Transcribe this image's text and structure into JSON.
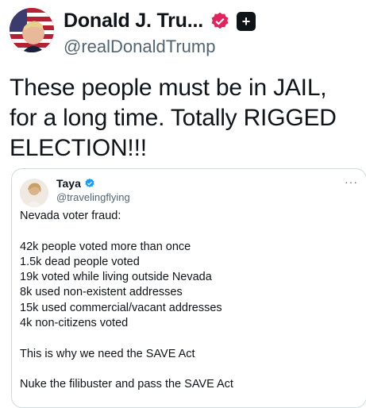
{
  "post": {
    "author_name": "Donald J. Tru...",
    "author_handle": "@realDonaldTrump",
    "text": "These people must be in JAIL, for a long time. Totally RIGGED ELECTION!!!",
    "affiliation_badge": "+"
  },
  "quoted_post": {
    "author_name": "Taya",
    "author_handle": "@travelingflying",
    "more_label": "···",
    "lines": [
      "Nevada voter fraud:",
      "",
      "42k people voted more than once",
      "1.5k dead people voted",
      "19k voted while living outside Nevada",
      "8k used non-existent addresses",
      "15k used commercial/vacant addresses",
      "4k non-citizens voted",
      "",
      "This is why we need the SAVE Act",
      "",
      "Nuke the filibuster and pass the SAVE Act"
    ]
  },
  "colors": {
    "text_primary": "#0f1419",
    "text_secondary": "#536471",
    "verified_gold_pink": "#e0245e",
    "verified_blue": "#1d9bf0",
    "border": "#cfd9de"
  },
  "icons": {
    "verified": "verified-badge-icon",
    "affiliation": "affiliation-badge-icon",
    "more": "more-options-icon"
  }
}
